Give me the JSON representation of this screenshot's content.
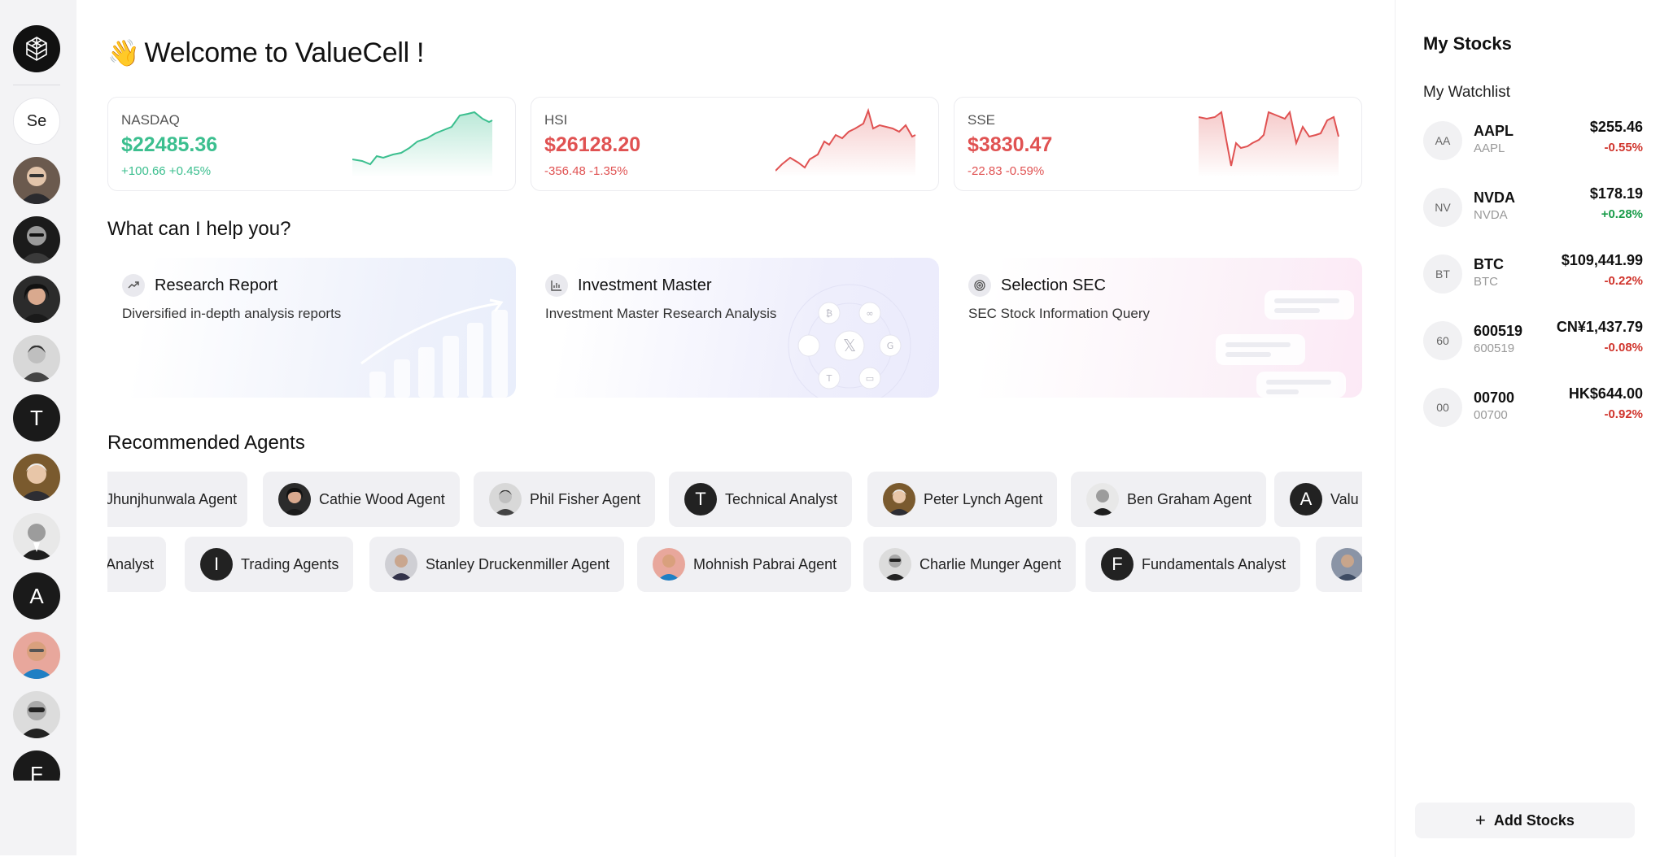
{
  "colors": {
    "up": "#3cbf8f",
    "down": "#e05252",
    "up_text": "#1a9c4a",
    "down_text": "#d0342c"
  },
  "header": {
    "wave": "👋",
    "title": "Welcome to ValueCell !"
  },
  "indices": [
    {
      "name": "NASDAQ",
      "value": "$22485.36",
      "change": "+100.66 +0.45%",
      "trend": "up"
    },
    {
      "name": "HSI",
      "value": "$26128.20",
      "change": "-356.48 -1.35%",
      "trend": "down"
    },
    {
      "name": "SSE",
      "value": "$3830.47",
      "change": "-22.83 -0.59%",
      "trend": "down"
    }
  ],
  "help": {
    "title": "What can I help you?",
    "cards": [
      {
        "icon": "trend-icon",
        "title": "Research Report",
        "desc": "Diversified in-depth analysis reports"
      },
      {
        "icon": "bar-chart-icon",
        "title": "Investment Master",
        "desc": "Investment Master Research Analysis"
      },
      {
        "icon": "target-icon",
        "title": "Selection SEC",
        "desc": "SEC Stock Information Query"
      }
    ]
  },
  "recommended": {
    "title": "Recommended Agents",
    "row1": [
      {
        "label": "Jhunjhunwala Agent",
        "avatar": ""
      },
      {
        "label": "Cathie Wood Agent",
        "avatar": "photo"
      },
      {
        "label": "Phil Fisher Agent",
        "avatar": "photo"
      },
      {
        "label": "Technical Analyst",
        "avatar": "T"
      },
      {
        "label": "Peter Lynch Agent",
        "avatar": "photo"
      },
      {
        "label": "Ben Graham Agent",
        "avatar": "photo"
      },
      {
        "label": "Valu",
        "avatar": "A"
      }
    ],
    "row2": [
      {
        "label": "Analyst",
        "avatar": ""
      },
      {
        "label": "Trading Agents",
        "avatar": "I"
      },
      {
        "label": "Stanley Druckenmiller Agent",
        "avatar": "photo"
      },
      {
        "label": "Mohnish Pabrai Agent",
        "avatar": "photo"
      },
      {
        "label": "Charlie Munger Agent",
        "avatar": "photo"
      },
      {
        "label": "Fundamentals Analyst",
        "avatar": "F"
      },
      {
        "label": "",
        "avatar": "photo"
      }
    ]
  },
  "rail": {
    "logo": "valuecell-logo-icon",
    "items": [
      {
        "type": "text",
        "label": "Se"
      },
      {
        "type": "photo"
      },
      {
        "type": "photo"
      },
      {
        "type": "photo"
      },
      {
        "type": "photo"
      },
      {
        "type": "letter",
        "label": "T"
      },
      {
        "type": "photo"
      },
      {
        "type": "photo"
      },
      {
        "type": "letter",
        "label": "A"
      },
      {
        "type": "photo"
      },
      {
        "type": "photo"
      },
      {
        "type": "letter",
        "label": "F"
      }
    ]
  },
  "right": {
    "title": "My Stocks",
    "watchlist_label": "My Watchlist",
    "stocks": [
      {
        "abbr": "AA",
        "symbol": "AAPL",
        "sub": "AAPL",
        "price": "$255.46",
        "change": "-0.55%",
        "trend": "down"
      },
      {
        "abbr": "NV",
        "symbol": "NVDA",
        "sub": "NVDA",
        "price": "$178.19",
        "change": "+0.28%",
        "trend": "up"
      },
      {
        "abbr": "BT",
        "symbol": "BTC",
        "sub": "BTC",
        "price": "$109,441.99",
        "change": "-0.22%",
        "trend": "down"
      },
      {
        "abbr": "60",
        "symbol": "600519",
        "sub": "600519",
        "price": "CN¥1,437.79",
        "change": "-0.08%",
        "trend": "down"
      },
      {
        "abbr": "00",
        "symbol": "00700",
        "sub": "00700",
        "price": "HK$644.00",
        "change": "-0.92%",
        "trend": "down"
      }
    ],
    "add_button": "Add Stocks"
  }
}
